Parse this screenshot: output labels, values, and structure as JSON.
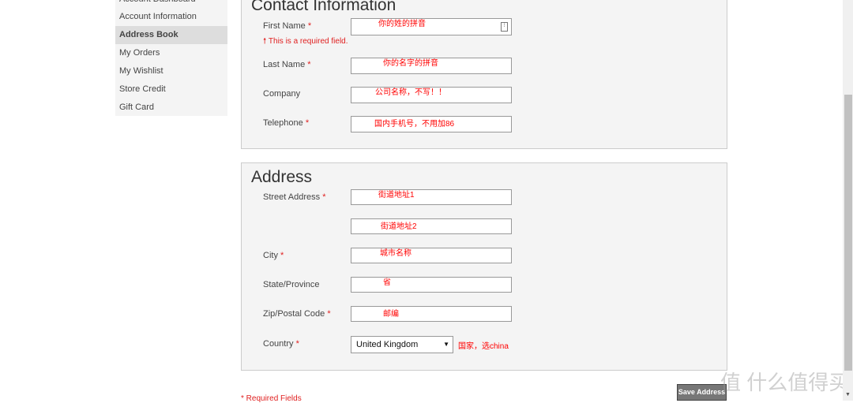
{
  "sidebar": {
    "items": [
      {
        "label": "Account Dashboard"
      },
      {
        "label": "Account Information"
      },
      {
        "label": "Address Book",
        "active": true
      },
      {
        "label": "My Orders"
      },
      {
        "label": "My Wishlist"
      },
      {
        "label": "Store Credit"
      },
      {
        "label": "Gift Card"
      }
    ]
  },
  "contact": {
    "legend": "Contact Information",
    "first_name": {
      "label": "First Name",
      "value": "你的姓的拼音",
      "error": "This is a required field."
    },
    "last_name": {
      "label": "Last Name",
      "value": "你的名字的拼音"
    },
    "company": {
      "label": "Company",
      "value": "公司名称，不写！！"
    },
    "telephone": {
      "label": "Telephone",
      "value": "国内手机号，不用加86"
    }
  },
  "address": {
    "legend": "Address",
    "street": {
      "label": "Street Address",
      "value1": "街道地址1",
      "value2": "街道地址2"
    },
    "city": {
      "label": "City",
      "value": "城市名称"
    },
    "state": {
      "label": "State/Province",
      "value": "省"
    },
    "zip": {
      "label": "Zip/Postal Code",
      "value": "邮编"
    },
    "country": {
      "label": "Country",
      "value": "United Kingdom",
      "note": "国家，选china"
    }
  },
  "required_mark": "*",
  "required_note": "* Required Fields",
  "save_label": "Save Address",
  "watermark": "值 什么值得买",
  "colors": {
    "required": "#e02020",
    "annotation": "#ff0000"
  }
}
